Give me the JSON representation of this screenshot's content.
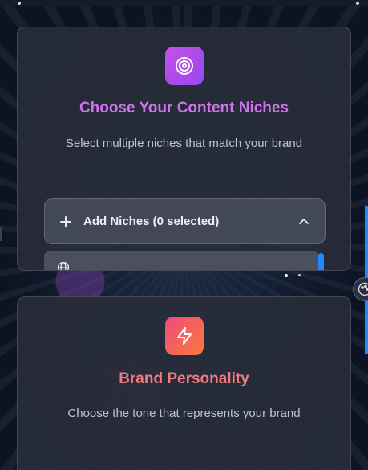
{
  "niches_card": {
    "icon": "target-icon",
    "title": "Choose Your Content Niches",
    "subtitle": "Select multiple niches that match your brand",
    "dropdown_label": "Add Niches (0 selected)",
    "dropdown_expanded": true,
    "accent": "#cf72ec"
  },
  "personality_card": {
    "icon": "lightning-icon",
    "title": "Brand Personality",
    "subtitle": "Choose the tone that represents your brand",
    "accent": "#f17a82"
  },
  "colors": {
    "background": "#0b1220",
    "card": "#282d3a",
    "scroll_accent": "#1a8cff"
  }
}
